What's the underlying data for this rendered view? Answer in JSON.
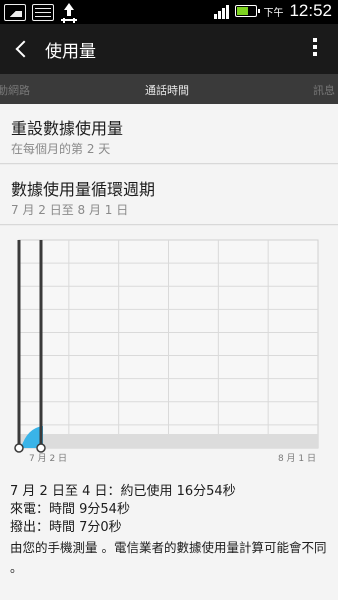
{
  "status_bar": {
    "ampm": "下午",
    "time": "12:52",
    "icons": [
      "gallery-icon",
      "mail-icon",
      "upload-icon",
      "signal-icon",
      "battery-icon"
    ],
    "battery_color": "#7ed321"
  },
  "action_bar": {
    "title": "使用量",
    "back_icon": "back-icon",
    "overflow_icon": "overflow-icon"
  },
  "tabs": [
    {
      "label": "行動網路"
    },
    {
      "label": "通話時間"
    },
    {
      "label": "訊息"
    }
  ],
  "settings": {
    "reset": {
      "title": "重設數據使用量",
      "subtitle": "在每個月的第 2 天"
    },
    "cycle": {
      "title": "數據使用量循環週期",
      "subtitle": "7 月 2 日至 8 月 1 日"
    }
  },
  "chart_data": {
    "type": "area",
    "x_start_label": "7 月 2 日",
    "x_end_label": "8 月 1 日",
    "series": [
      {
        "x": [
          "7 月 2 日",
          "7 月 4 日"
        ],
        "values": [
          0,
          1
        ]
      }
    ],
    "grid": true,
    "accent_color": "#3ab4e8",
    "selection_handles": [
      "7 月 2 日",
      "7 月 4 日"
    ]
  },
  "summary": {
    "range_usage": "7 月 2 日至 4 日：約已使用 16分54秒",
    "incoming": "來電：時間 9分54秒",
    "outgoing": "撥出：時間 7分0秒",
    "note": "由您的手機測量 。電信業者的數據使用量計算可能會不同 。"
  }
}
